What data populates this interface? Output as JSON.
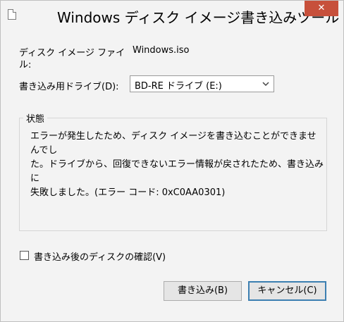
{
  "window": {
    "title": "Windows ディスク イメージ書き込みツール",
    "close_label": "✕"
  },
  "fields": {
    "image_file_label_line1": "ディスク イメージ ファイ",
    "image_file_label_line2": "ル:",
    "image_file_value": "Windows.iso",
    "drive_label": "書き込み用ドライブ(D):",
    "drive_selected": "BD-RE ドライブ (E:)"
  },
  "status": {
    "legend": "状態",
    "message": "エラーが発生したため、ディスク イメージを書き込むことができませんでし\nた。ドライブから、回復できないエラー情報が戻されたため、書き込みに\n失敗しました。(エラー コード: 0xC0AA0301)"
  },
  "verify": {
    "label": "書き込み後のディスクの確認(V)",
    "checked": false
  },
  "buttons": {
    "write_label": "書き込み(B)",
    "cancel_label": "キャンセル(C)"
  }
}
